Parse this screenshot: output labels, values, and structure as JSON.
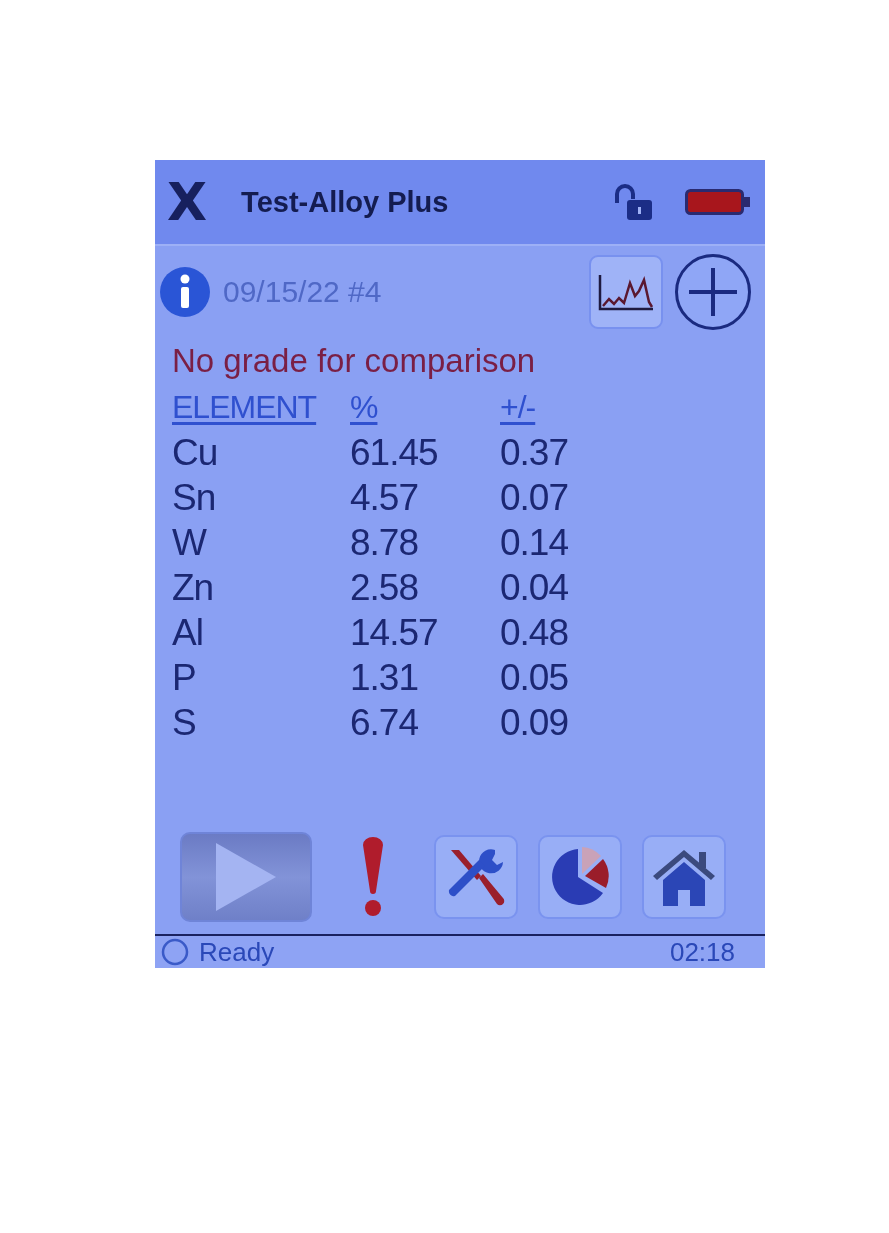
{
  "title_bar": {
    "logo": "X",
    "title": "Test-Alloy Plus"
  },
  "info_row": {
    "sample": "09/15/22 #4"
  },
  "message": "No grade for comparison",
  "table": {
    "columns": [
      "ELEMENT",
      "%",
      "+/-"
    ],
    "rows": [
      [
        "Cu",
        "61.45",
        "0.37"
      ],
      [
        "Sn",
        "4.57",
        "0.07"
      ],
      [
        "W",
        "8.78",
        "0.14"
      ],
      [
        "Zn",
        "2.58",
        "0.04"
      ],
      [
        "Al",
        "14.57",
        "0.48"
      ],
      [
        "P",
        "1.31",
        "0.05"
      ],
      [
        "S",
        "6.74",
        "0.09"
      ]
    ]
  },
  "toolbar": [
    {
      "kind": "play"
    },
    {
      "kind": "alert"
    },
    {
      "kind": "tools"
    },
    {
      "kind": "chart"
    },
    {
      "kind": "home"
    }
  ],
  "status_bar": {
    "status": "Ready",
    "time": "02:18"
  }
}
